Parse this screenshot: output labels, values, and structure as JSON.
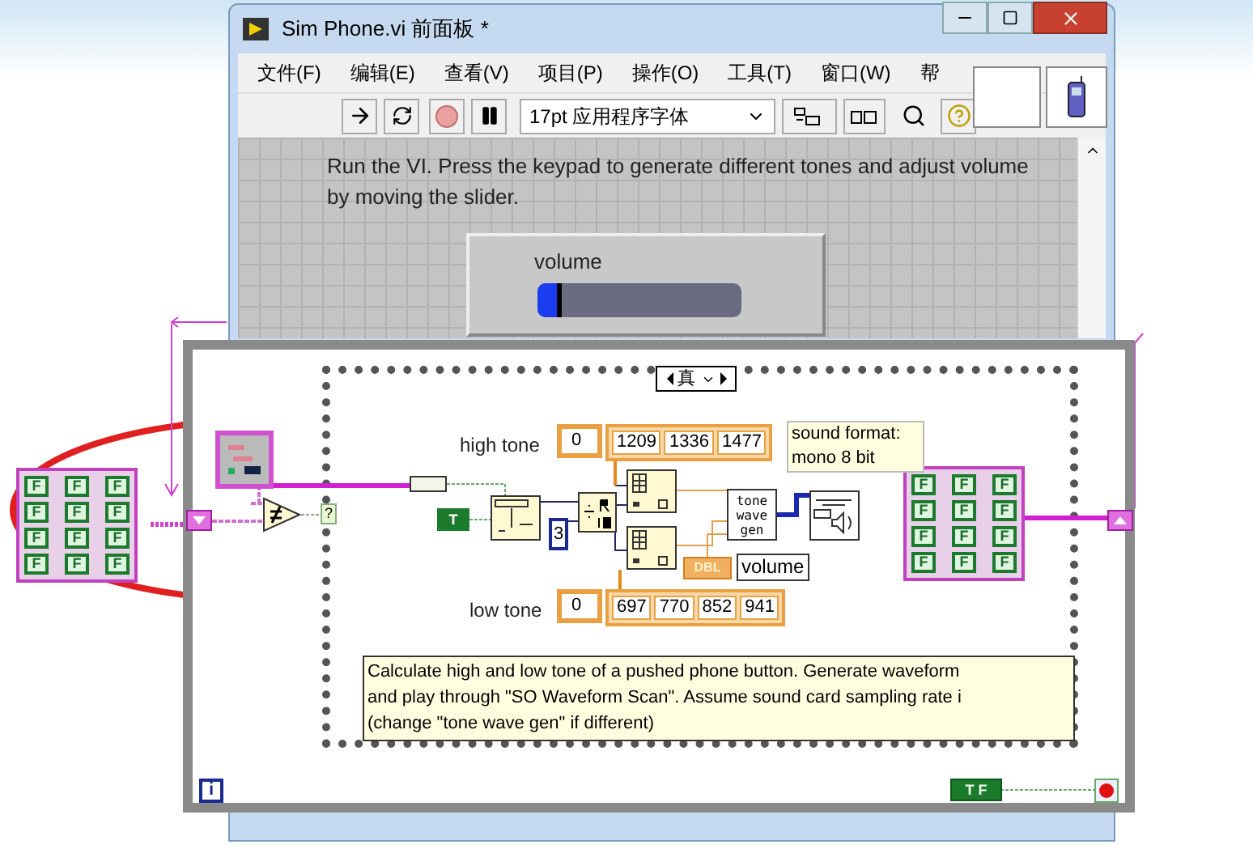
{
  "window": {
    "title": "Sim Phone.vi 前面板 *"
  },
  "menu": [
    {
      "label": "文件(F)"
    },
    {
      "label": "编辑(E)"
    },
    {
      "label": "查看(V)"
    },
    {
      "label": "项目(P)"
    },
    {
      "label": "操作(O)"
    },
    {
      "label": "工具(T)"
    },
    {
      "label": "窗口(W)"
    },
    {
      "label": "帮"
    }
  ],
  "toolbar": {
    "font_selector": "17pt 应用程序字体"
  },
  "front_panel": {
    "instructions": "Run the VI. Press the keypad to generate different tones and adjust volume by moving the slider.",
    "volume": {
      "label": "volume",
      "level": 0.12
    }
  },
  "block_diagram": {
    "keypad_array_in": [
      "F",
      "F",
      "F",
      "F",
      "F",
      "F",
      "F",
      "F",
      "F",
      "F",
      "F",
      "F"
    ],
    "case_selector": "?",
    "case_label": "真",
    "high_tone": {
      "label": "high tone",
      "index": "0",
      "values": [
        "1209",
        "1336",
        "1477"
      ]
    },
    "bool_constant": "T",
    "divisor": "3",
    "sub_vi": "tone wave gen",
    "comment_format": "sound format: mono 8 bit",
    "volume_type": "DBL",
    "volume_local": "volume",
    "keypad_array_out": [
      "F",
      "F",
      "F",
      "F",
      "F",
      "F",
      "F",
      "F",
      "F",
      "F",
      "F",
      "F"
    ],
    "low_tone": {
      "label": "low tone",
      "index": "0",
      "values": [
        "697",
        "770",
        "852",
        "941"
      ]
    },
    "description": [
      "Calculate high and low tone of a pushed phone button.  Generate waveform",
      "and play through \"SO Waveform Scan\".  Assume sound card sampling rate i",
      "(change \"tone wave gen\" if different)"
    ],
    "iteration": "i",
    "stop_constant": "T F"
  }
}
